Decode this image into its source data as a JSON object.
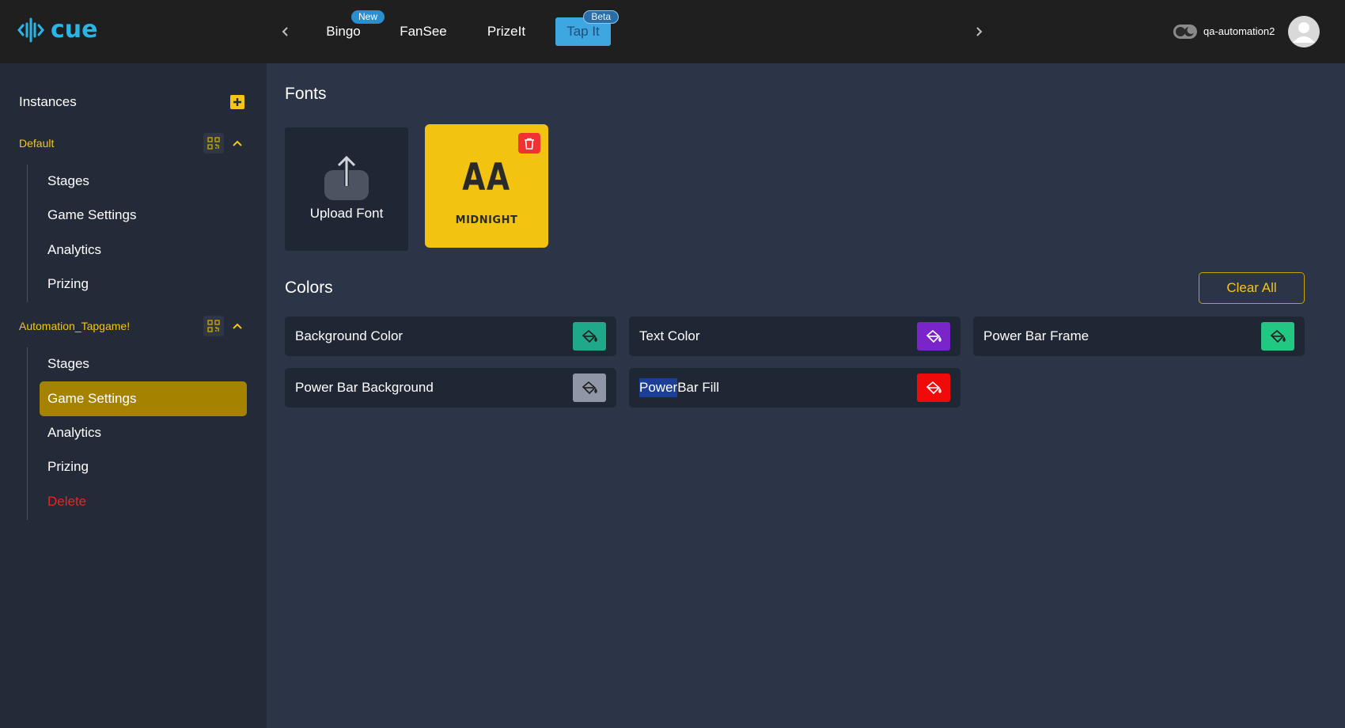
{
  "header": {
    "logo_text": "cue",
    "tabs": [
      {
        "label": "Bingo",
        "badge": "New"
      },
      {
        "label": "FanSee"
      },
      {
        "label": "PrizeIt"
      },
      {
        "label": "Tap It",
        "badge": "Beta",
        "active": true
      }
    ],
    "username": "qa-automation2"
  },
  "sidebar": {
    "title": "Instances",
    "groups": [
      {
        "name": "Default",
        "items": [
          "Stages",
          "Game Settings",
          "Analytics",
          "Prizing"
        ]
      },
      {
        "name": "Automation_Tapgame!",
        "items": [
          "Stages",
          "Game Settings",
          "Analytics",
          "Prizing"
        ],
        "active_item": "Game Settings",
        "delete_label": "Delete"
      }
    ]
  },
  "fonts": {
    "title": "Fonts",
    "upload_label": "Upload Font",
    "card": {
      "sample": "AA",
      "name": "MIDNIGHT"
    }
  },
  "colors": {
    "title": "Colors",
    "clear_all_label": "Clear All",
    "items": [
      {
        "label": "Background Color",
        "color": "#1fa88a"
      },
      {
        "label": "Text Color",
        "color": "#7a25c9"
      },
      {
        "label": "Power Bar Frame",
        "color": "#22c784"
      },
      {
        "label": "Power Bar Background",
        "color": "#8f97a6"
      },
      {
        "label_highlight": "Power",
        "label_rest": " Bar Fill",
        "color": "#f00a0a"
      }
    ]
  },
  "icons": {
    "logo": "soundwave-icon",
    "nav_prev": "chevron-left-icon",
    "nav_next": "chevron-right-icon",
    "theme": "moon-icon",
    "avatar": "user-icon",
    "add": "plus-icon",
    "qr": "qr-code-icon",
    "collapse": "chevron-up-icon",
    "upload": "upload-icon",
    "delete": "trash-icon",
    "color_picker": "paint-bucket-icon"
  }
}
